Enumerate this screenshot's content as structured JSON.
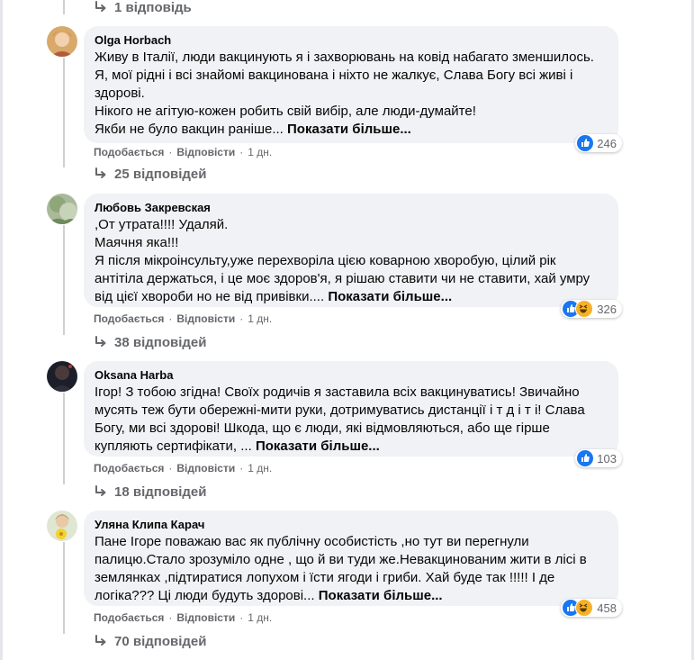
{
  "comments": [
    {
      "author": "Olga Horbach",
      "lines": [
        "Живу в Італії, люди вакцинують я і захворювань на ковід набагато зменшилось.",
        "Я, мої рідні і всі знайомі вакцинована і ніхто не жалкує, Слава Богу всі живі і",
        "здорові.",
        "Нікого не агітую-кожен робить свій вибір, але люди-думайте!"
      ],
      "last_line": "Якби не було вакцин раніше...",
      "see_more": "Показати більше...",
      "reactions": [
        "like"
      ],
      "reaction_count": "246",
      "like_label": "Подобається",
      "reply_label": "Відповісти",
      "time": "1 дн.",
      "replies_label": "25 відповідей"
    },
    {
      "author": "Любовь Закревская",
      "lines": [
        ",От утрата!!!! Удаляй.",
        "Маячня яка!!!",
        "Я після мікроінсульту,уже перехворіла цією коварною хворобую, цілий рік",
        "антітіла держаться, і це моє здоров'я, я рішаю ставити чи не ставити, хай умру"
      ],
      "last_line": "від цієї хвороби но не від привівки....",
      "see_more": "Показати більше...",
      "reactions": [
        "like",
        "haha"
      ],
      "reaction_count": "326",
      "like_label": "Подобається",
      "reply_label": "Відповісти",
      "time": "1 дн.",
      "replies_label": "38 відповідей"
    },
    {
      "author": "Oksana Harba",
      "lines": [
        "Ігор! З тобою згідна! Своїх родичів я заставила всіх вакцинуватись! Звичайно",
        "мусять теж бути обережні-мити руки, дотримуватись дистанції і т д і т і! Слава",
        "Богу, ми всі здорові! Шкода, що є люди, які відмовляються, або ще гірше"
      ],
      "last_line": "купляють сертифікати, ...",
      "see_more": "Показати більше...",
      "reactions": [
        "like"
      ],
      "reaction_count": "103",
      "like_label": "Подобається",
      "reply_label": "Відповісти",
      "time": "1 дн.",
      "replies_label": "18 відповідей"
    },
    {
      "author": "Уляна Клипа Карач",
      "lines": [
        "Пане Ігоре поважаю вас як публічну особистість ,но тут ви перегнули",
        "палицю.Стало зрозуміло одне , що й ви туди же.Невакцинованим жити в лісі в",
        "землянках ,підтиратися лопухом і їсти ягоди і гриби. Хай буде так !!!!! І де"
      ],
      "last_line": "логіка??? Ці люди будуть здорові...",
      "see_more": "Показати більше...",
      "reactions": [
        "like",
        "haha"
      ],
      "reaction_count": "458",
      "like_label": "Подобається",
      "reply_label": "Відповісти",
      "time": "1 дн.",
      "replies_label": "70 відповідей"
    }
  ],
  "top_replies_label": "1 відповідь",
  "colors": {
    "bubble": "#f0f2f5",
    "secondary_text": "#65676b",
    "like_blue": "#1877f2",
    "haha_yellow": "#f7b125"
  }
}
